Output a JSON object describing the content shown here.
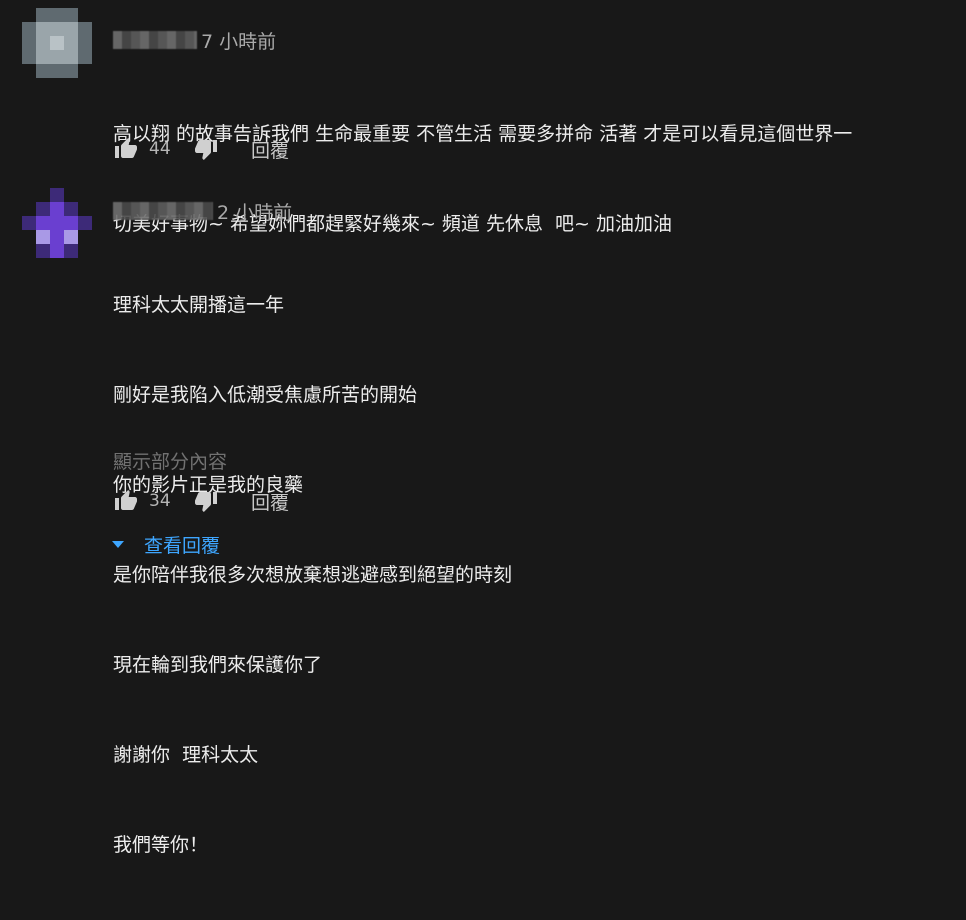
{
  "comments": [
    {
      "timestamp": "7 小時前",
      "text_lines": [
        "高以翔 的故事告訴我們 生命最重要 不管生活 需要多拼命 活著 才是可以看見這個世界一",
        "切美好事物~ 希望妳們都趕緊好幾來~ 頻道 先休息  吧~ 加油加油"
      ],
      "like_count": "44",
      "reply_label": "回覆",
      "avatar_palette": [
        "#5f6a70",
        "#9aa5aa",
        "#b9c2c6",
        "#7e898e"
      ]
    },
    {
      "timestamp": "2 小時前",
      "text_lines": [
        "理科太太開播這一年",
        "剛好是我陷入低潮受焦慮所苦的開始",
        "你的影片正是我的良藥",
        "是你陪伴我很多次想放棄想逃避感到絕望的時刻",
        "現在輪到我們來保護你了",
        "謝謝你  理科太太",
        "我們等你！"
      ],
      "show_more": "顯示部分內容",
      "like_count": "34",
      "reply_label": "回覆",
      "avatar_palette": [
        "#3d2a78",
        "#6a3fd0",
        "#a999e6",
        "#5232a6"
      ]
    }
  ],
  "view_replies_label": "查看回覆",
  "colors": {
    "background": "#181818",
    "accent": "#3ea6ff"
  }
}
